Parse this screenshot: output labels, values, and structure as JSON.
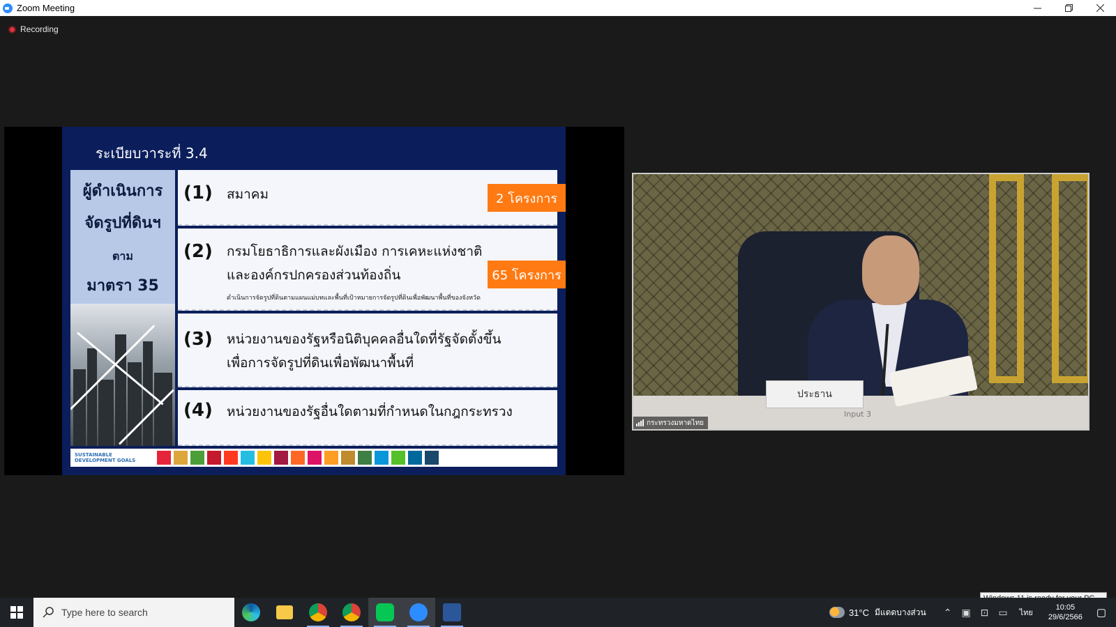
{
  "window": {
    "title": "Zoom Meeting",
    "minimize_icon": "minimize-icon",
    "restore_icon": "restore-icon",
    "close_icon": "close-icon"
  },
  "recording": {
    "label": "Recording",
    "dot_color": "#e0333b"
  },
  "slide": {
    "title": "ระเบียบวาระที่ 3.4",
    "left_panel": {
      "line1": "ผู้ดำเนินการ",
      "line2": "จัดรูปที่ดินฯ",
      "line3": "ตาม",
      "line4": "มาตรา 35"
    },
    "rows": [
      {
        "num": "(1)",
        "text1": "สมาคม",
        "badge": "2 โครงการ"
      },
      {
        "num": "(2)",
        "text1": "กรมโยธาธิการและผังเมือง การเคหะแห่งชาติ",
        "text2": "และองค์กรปกครองส่วนท้องถิ่น",
        "sub": "ดำเนินการจัดรูปที่ดินตามแผนแม่บทและพื้นที่เป้าหมายการจัดรูปที่ดินเพื่อพัฒนาพื้นที่ของจังหวัด",
        "badge": "65 โครงการ"
      },
      {
        "num": "(3)",
        "text1": "หน่วยงานของรัฐหรือนิติบุคคลอื่นใดที่รัฐจัดตั้งขึ้น",
        "text2": "เพื่อการจัดรูปที่ดินเพื่อพัฒนาพื้นที่"
      },
      {
        "num": "(4)",
        "text1": "หน่วยงานของรัฐอื่นใดตามที่กำหนดในกฎกระทรวง"
      }
    ],
    "sdg_label": "SUSTAINABLE DEVELOPMENT GOALS",
    "badge_color": "#ff7a12",
    "sdg_colors": [
      "#e5243b",
      "#dda63a",
      "#4c9f38",
      "#c5192d",
      "#ff3a21",
      "#26bde2",
      "#fcc30b",
      "#a21942",
      "#fd6925",
      "#dd1367",
      "#fd9d24",
      "#bf8b2e",
      "#3f7e44",
      "#0a97d9",
      "#56c02b",
      "#00689d",
      "#19486a"
    ]
  },
  "video": {
    "nameplate": "ประธาน",
    "input_label": "Input 3",
    "participant_name": "กระทรวงมหาดไทย"
  },
  "taskbar": {
    "search_placeholder": "Type here to search",
    "apps": [
      "edge-icon",
      "file-explorer-icon",
      "chrome-icon",
      "chrome-profile-icon",
      "line-icon",
      "zoom-icon",
      "word-icon"
    ],
    "weather_temp": "31°C",
    "weather_text": "มีแดดบางส่วน",
    "language": "ไทย",
    "time": "10:05",
    "date": "29/6/2566"
  },
  "toast": {
    "text": "Windows 11 is ready for your PC."
  }
}
